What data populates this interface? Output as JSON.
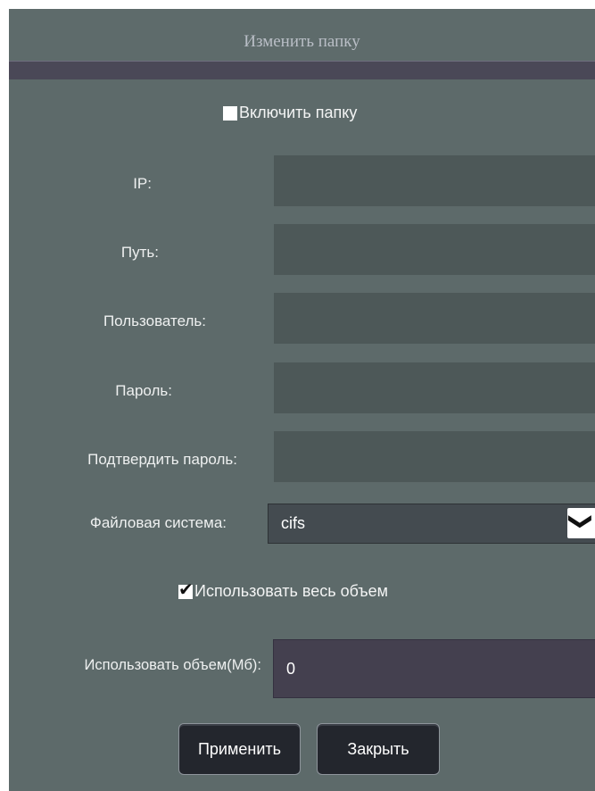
{
  "dialog": {
    "title": "Изменить папку",
    "enable_folder": {
      "label": "Включить папку",
      "checked": false
    },
    "fields": [
      {
        "label": "IP:",
        "value": ""
      },
      {
        "label": "Путь:",
        "value": ""
      },
      {
        "label": "Пользователь:",
        "value": ""
      },
      {
        "label": "Пароль:",
        "value": ""
      },
      {
        "label": "Подтвердить пароль:",
        "value": ""
      }
    ],
    "filesystem": {
      "label": "Файловая система:",
      "value": "cifs"
    },
    "use_full_volume": {
      "label": "Использовать весь объем",
      "checked": true
    },
    "volume": {
      "label": "Использовать объем(Мб):",
      "value": "0"
    },
    "apply_label": "Применить",
    "close_label": "Закрыть"
  },
  "colors": {
    "panel": "#5d6a6a",
    "input": "#4d5858",
    "title_strip": "#4a4857",
    "button": "#23262d"
  },
  "icons": {
    "dropdown": "chevron-down-icon",
    "checkbox_checked": "checkmark-icon"
  }
}
